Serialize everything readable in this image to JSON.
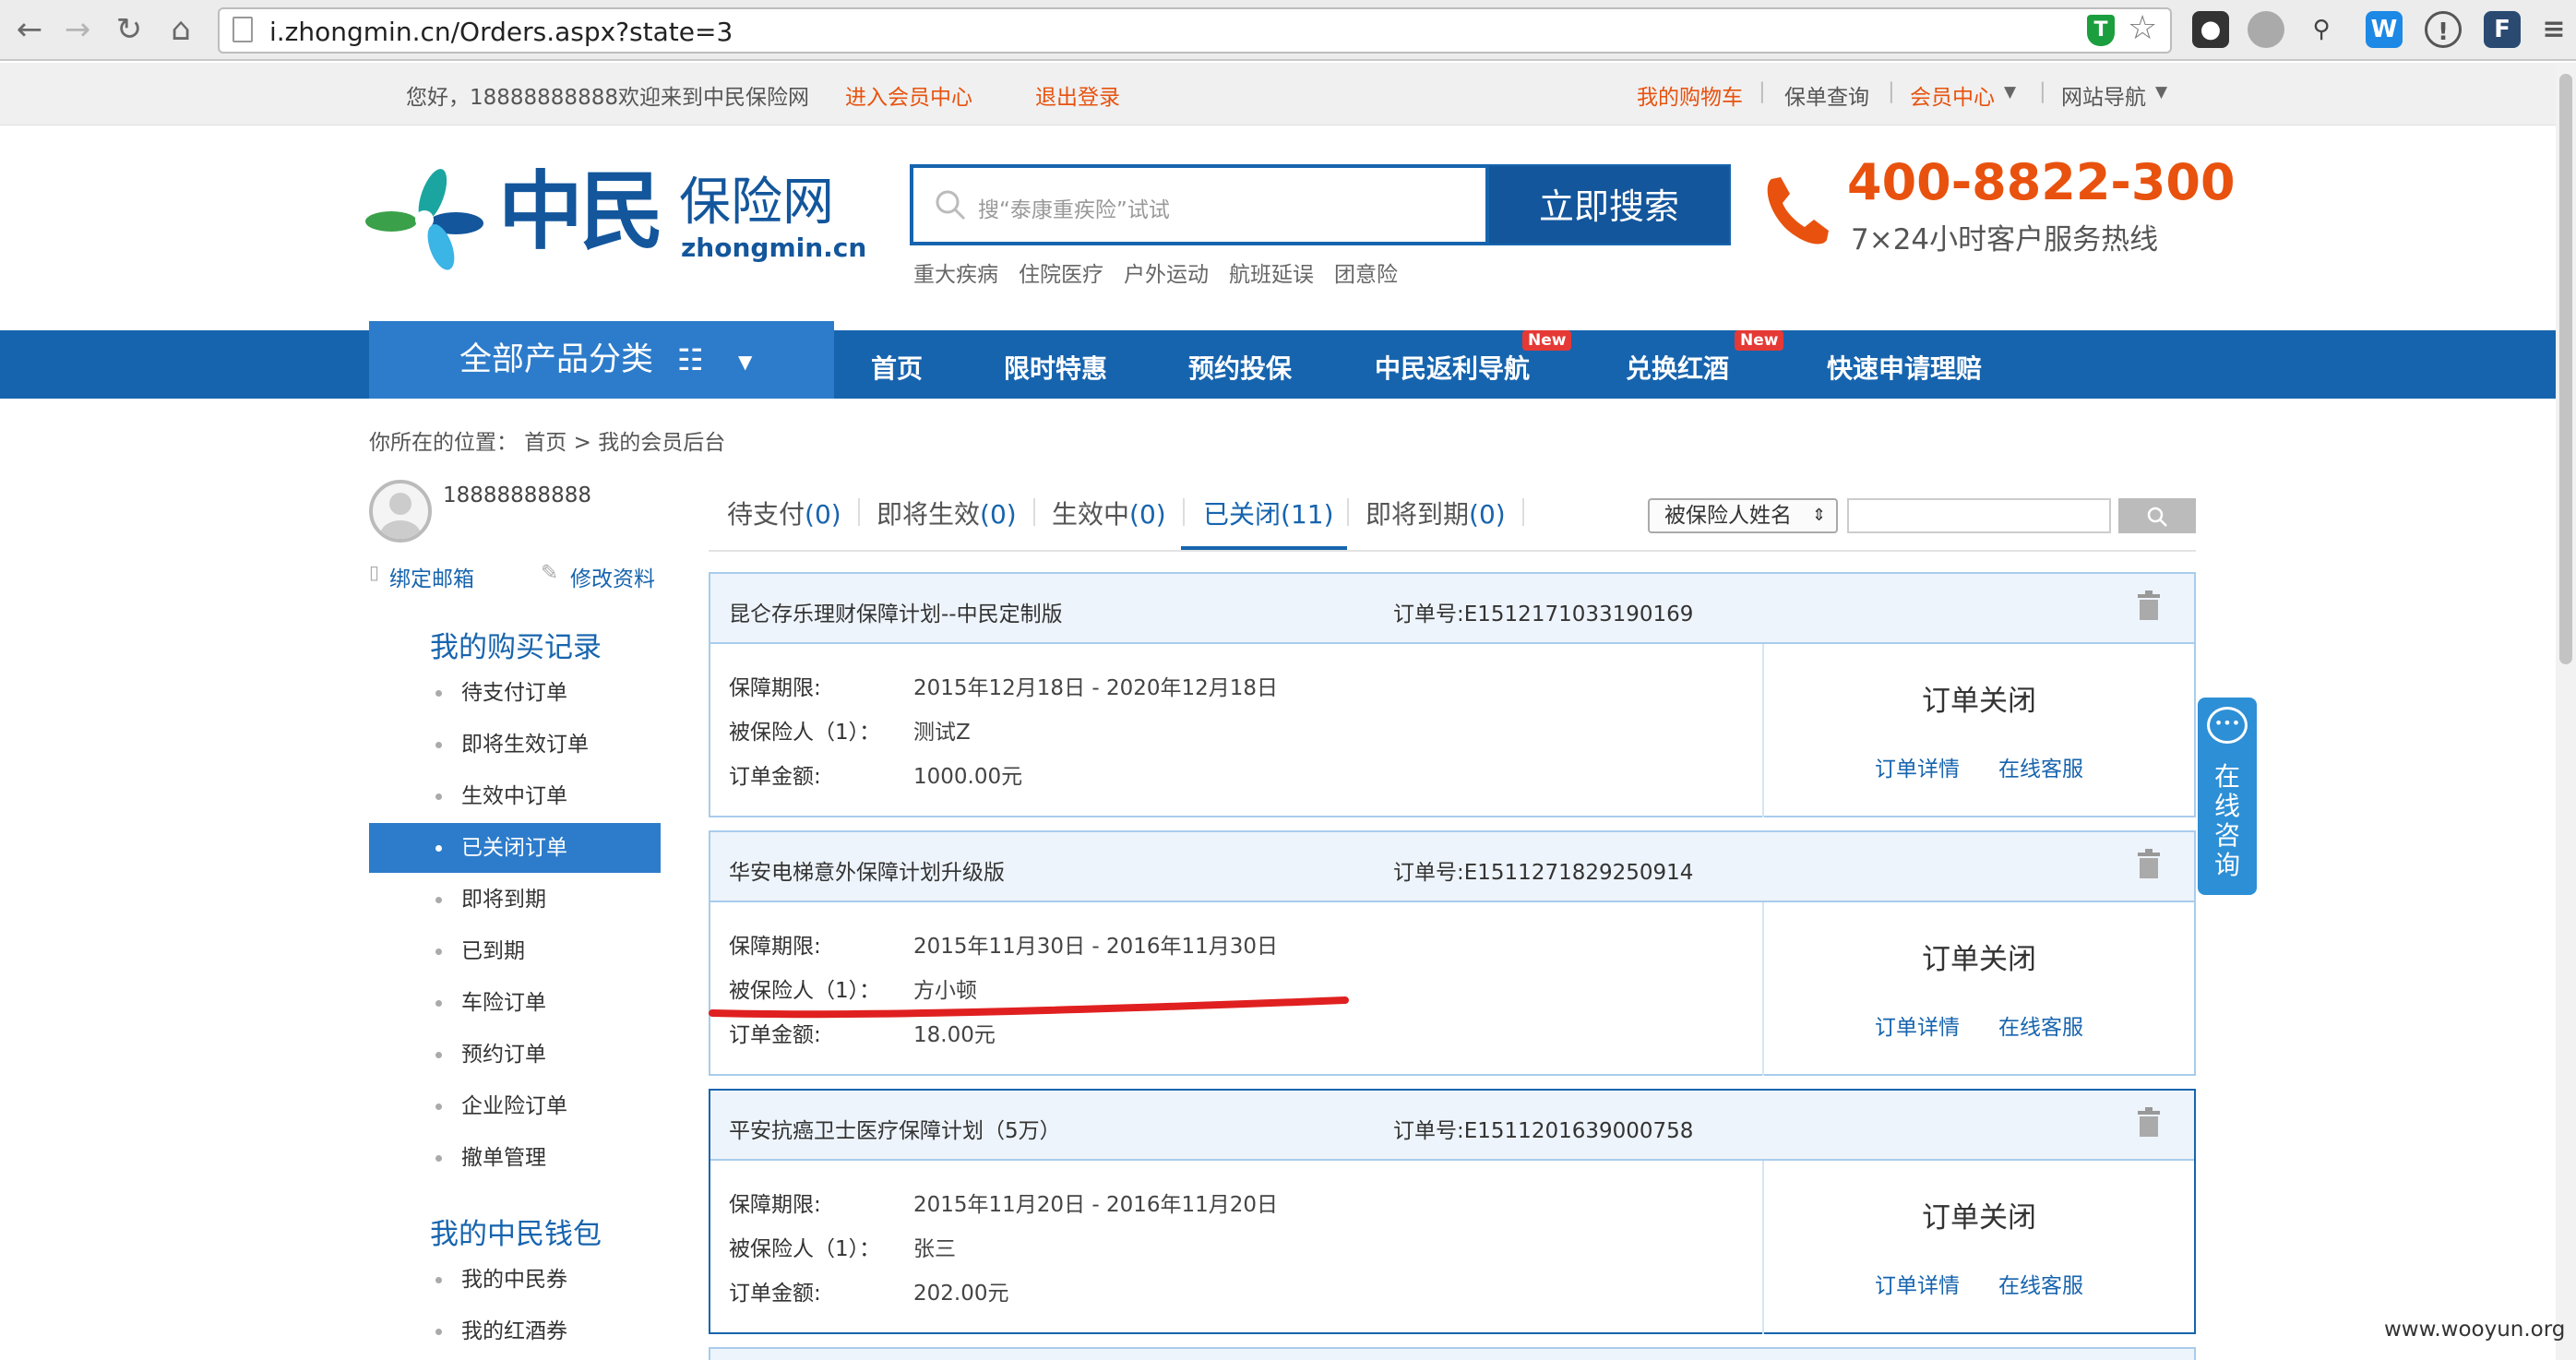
{
  "browser": {
    "url": "i.zhongmin.cn/Orders.aspx?state=3",
    "icons": [
      "back-icon",
      "forward-icon",
      "reload-icon",
      "home-icon",
      "page-icon",
      "shield-icon",
      "star-icon"
    ]
  },
  "topbar": {
    "greeting": "您好，18888888888欢迎来到中民保险网",
    "member_center": "进入会员中心",
    "logout": "退出登录",
    "cart": "我的购物车",
    "policy_query": "保单查询",
    "member_menu": "会员中心",
    "site_nav": "网站导航"
  },
  "header": {
    "logo_cn": "中民",
    "logo_cn2": "保险网",
    "logo_en": "zhongmin.cn",
    "search_placeholder": "搜“泰康重疾险”试试",
    "search_button": "立即搜索",
    "hot_links": [
      "重大疾病",
      "住院医疗",
      "户外运动",
      "航班延误",
      "团意险"
    ],
    "phone": "400-8822-300",
    "phone_sub": "7×24小时客户服务热线"
  },
  "nav": {
    "all_categories": "全部产品分类",
    "items": [
      "首页",
      "限时特惠",
      "预约投保",
      "中民返利导航",
      "兑换红酒",
      "快速申请理赔"
    ],
    "new_badge": "New"
  },
  "breadcrumb": "你所在的位置： 首页 > 我的会员后台",
  "sidebar": {
    "username": "18888888888",
    "bind_email": "绑定邮箱",
    "edit_profile": "修改资料",
    "purchase_title": "我的购买记录",
    "purchase_items": [
      "待支付订单",
      "即将生效订单",
      "生效中订单",
      "已关闭订单",
      "即将到期",
      "已到期",
      "车险订单",
      "预约订单",
      "企业险订单",
      "撤单管理"
    ],
    "active_index": 3,
    "wallet_title": "我的中民钱包",
    "wallet_items": [
      "我的中民券",
      "我的红酒券"
    ]
  },
  "tabs": [
    {
      "label": "待支付",
      "count": "(0)"
    },
    {
      "label": "即将生效",
      "count": "(0)"
    },
    {
      "label": "生效中",
      "count": "(0)"
    },
    {
      "label": "已关闭",
      "count": "(11)"
    },
    {
      "label": "即将到期",
      "count": "(0)"
    }
  ],
  "filter": {
    "select": "被保险人姓名"
  },
  "labels": {
    "order_no": "订单号:",
    "period": "保障期限:",
    "insured": "被保险人（1）：",
    "amount": "订单金额:",
    "details": "订单详情",
    "service": "在线客服"
  },
  "orders": [
    {
      "name": "昆仑存乐理财保障计划--中民定制版",
      "number": "E1512171033190169",
      "period": "2015年12月18日 - 2020年12月18日",
      "insured": "测试Z",
      "amount": "1000.00元",
      "status": "订单关闭"
    },
    {
      "name": "华安电梯意外保障计划升级版",
      "number": "E1511271829250914",
      "period": "2015年11月30日 - 2016年11月30日",
      "insured": "方小顿",
      "amount": "18.00元",
      "status": "订单关闭"
    },
    {
      "name": "平安抗癌卫士医疗保障计划（5万）",
      "number": "E1511201639000758",
      "period": "2015年11月20日 - 2016年11月20日",
      "insured": "张三",
      "amount": "202.00元",
      "status": "订单关闭"
    }
  ],
  "float_consult": "在线咨询",
  "watermark": "www.wooyun.org",
  "colors": {
    "brand_blue": "#1764ae",
    "accent_orange": "#e8520e",
    "annotation_red": "#e02020"
  }
}
